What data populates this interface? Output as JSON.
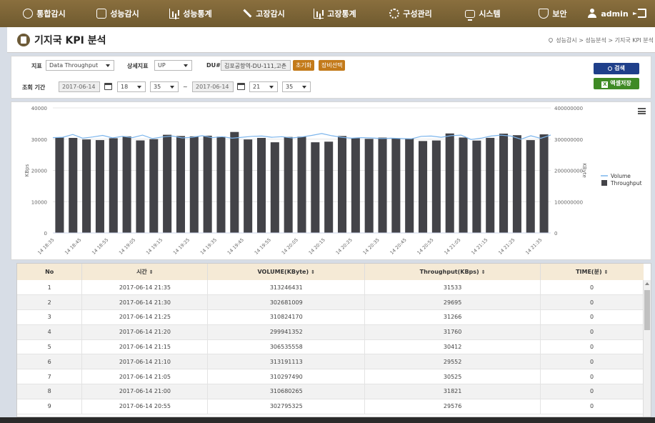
{
  "nav": {
    "items": [
      {
        "label": "통합감시",
        "icon": "dashboard-icon"
      },
      {
        "label": "성능감시",
        "icon": "monitor-chart-icon"
      },
      {
        "label": "성능통계",
        "icon": "bar-chart-icon"
      },
      {
        "label": "고장감시",
        "icon": "tool-icon"
      },
      {
        "label": "고장통계",
        "icon": "fault-chart-icon"
      },
      {
        "label": "구성관리",
        "icon": "gear-icon"
      },
      {
        "label": "시스템",
        "icon": "monitor-icon"
      },
      {
        "label": "보안",
        "icon": "shield-icon"
      },
      {
        "label": "admin",
        "icon": "user-icon"
      }
    ]
  },
  "title": {
    "text": "기지국 KPI 분석",
    "breadcrumb": "성능감시 > 성능분석 > 기지국 KPI 분석"
  },
  "filter": {
    "metric_label": "지표",
    "metric_value": "Data Throughput",
    "detail_label": "상세지표",
    "detail_value": "UP",
    "du_label": "DU#",
    "du_value": "김포공항역-DU-111,고촌",
    "reset_btn": "초기화",
    "equip_btn": "장비선택",
    "period_label": "조회 기간",
    "start_date": "2017-06-14",
    "start_hour": "18",
    "start_min": "35",
    "tilde": "~",
    "end_date": "2017-06-14",
    "end_hour": "21",
    "end_min": "35",
    "search_btn": "검색",
    "excel_btn": "엑셀저장",
    "excel_icon_text": "X"
  },
  "chart_data": {
    "type": "bar",
    "ylabel": "KBps",
    "y2label": "KByte",
    "ylim": [
      0,
      40000
    ],
    "y2lim": [
      0,
      400000000
    ],
    "yticks": [
      "0",
      "10000",
      "20000",
      "30000",
      "40000"
    ],
    "y2ticks": [
      "0",
      "100000000",
      "200000000",
      "300000000",
      "400000000"
    ],
    "xticklabels": [
      "14 18:35",
      "14 18:45",
      "14 18:55",
      "14 19:05",
      "14 19:15",
      "14 19:25",
      "14 19:35",
      "14 19:45",
      "14 19:55",
      "14 20:05",
      "14 20:15",
      "14 20:25",
      "14 20:35",
      "14 20:45",
      "14 20:55",
      "14 21:05",
      "14 21:15",
      "14 21:25",
      "14 21:35"
    ],
    "legend_position": "right",
    "series": [
      {
        "name": "Volume",
        "type": "line",
        "color": "#7cb5ec",
        "axis": "right",
        "values": [
          305000000,
          306000000,
          315000000,
          303000000,
          307000000,
          312000000,
          304000000,
          309000000,
          305000000,
          313000000,
          302000000,
          307000000,
          310000000,
          304000000,
          306000000,
          311000000,
          305000000,
          308000000,
          303000000,
          306000000,
          309000000,
          310000000,
          306000000,
          308000000,
          304000000,
          307000000,
          312000000,
          318000000,
          311000000,
          306000000,
          303000000,
          305000000,
          304000000,
          302000000,
          303000000,
          302000000,
          301000000,
          309000000,
          310000000,
          306000000,
          311000000,
          313000000,
          299000000,
          303000000,
          310000000,
          313000000,
          310000000,
          299941352,
          310824170,
          302681009,
          313246431
        ]
      },
      {
        "name": "Throughput",
        "type": "bar",
        "color": "#434348",
        "axis": "left",
        "values": [
          30500,
          30400,
          29900,
          29700,
          30300,
          30900,
          29600,
          30000,
          31400,
          31000,
          30900,
          31100,
          30800,
          32300,
          29900,
          30400,
          29000,
          30700,
          30800,
          29000,
          29200,
          31000,
          30300,
          30100,
          30500,
          30200,
          30200,
          29400,
          29576,
          31821,
          30525,
          29552,
          30412,
          31760,
          31266,
          29695,
          31533
        ]
      }
    ]
  },
  "table": {
    "columns": [
      "No",
      "시간",
      "VOLUME(KByte)",
      "Throughput(KBps)",
      "TIME(분)"
    ],
    "sortable": [
      false,
      true,
      true,
      true,
      true
    ],
    "sort_glyph": "⇕",
    "rows": [
      [
        "1",
        "2017-06-14 21:35",
        "313246431",
        "31533",
        "0"
      ],
      [
        "2",
        "2017-06-14 21:30",
        "302681009",
        "29695",
        "0"
      ],
      [
        "3",
        "2017-06-14 21:25",
        "310824170",
        "31266",
        "0"
      ],
      [
        "4",
        "2017-06-14 21:20",
        "299941352",
        "31760",
        "0"
      ],
      [
        "5",
        "2017-06-14 21:15",
        "306535558",
        "30412",
        "0"
      ],
      [
        "6",
        "2017-06-14 21:10",
        "313191113",
        "29552",
        "0"
      ],
      [
        "7",
        "2017-06-14 21:05",
        "310297490",
        "30525",
        "0"
      ],
      [
        "8",
        "2017-06-14 21:00",
        "310680265",
        "31821",
        "0"
      ],
      [
        "9",
        "2017-06-14 20:55",
        "302795325",
        "29576",
        "0"
      ]
    ]
  }
}
